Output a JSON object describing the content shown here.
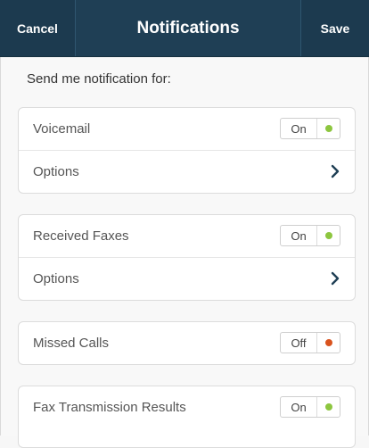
{
  "header": {
    "cancel_label": "Cancel",
    "title": "Notifications",
    "save_label": "Save"
  },
  "intro": "Send me notification for:",
  "sections": [
    {
      "label": "Voicemail",
      "toggle": "On",
      "options_label": "Options"
    },
    {
      "label": "Received Faxes",
      "toggle": "On",
      "options_label": "Options"
    },
    {
      "label": "Missed Calls",
      "toggle": "Off"
    },
    {
      "label": "Fax Transmission Results",
      "toggle": "On"
    }
  ],
  "colors": {
    "header_bg": "#1f3f55",
    "on_dot": "#8dc63f",
    "off_dot": "#d9531e"
  },
  "icons": {
    "options_chevron": "chevron-right-icon"
  }
}
